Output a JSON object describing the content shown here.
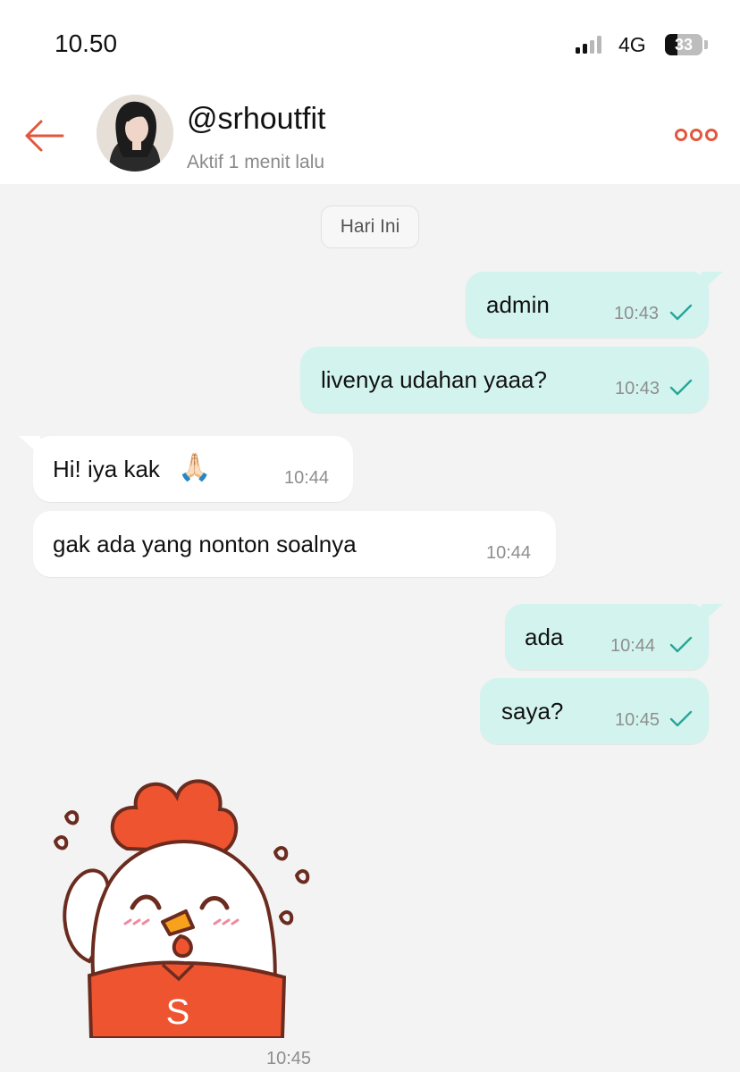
{
  "status_bar": {
    "time": "10.50",
    "network": "4G",
    "battery_level": "33"
  },
  "header": {
    "contact_name": "@srhoutfit",
    "contact_status": "Aktif 1 menit lalu",
    "accent_color": "#e2573c"
  },
  "chat": {
    "date_label": "Hari Ini",
    "messages": [
      {
        "direction": "out",
        "text": "admin",
        "time": "10:43",
        "read": true
      },
      {
        "direction": "out",
        "text": "livenya udahan yaaa?",
        "time": "10:43",
        "read": true
      },
      {
        "direction": "in",
        "text": "Hi! iya kak",
        "emoji": "🙏🏻",
        "time": "10:44"
      },
      {
        "direction": "in",
        "text": "gak ada yang nonton soalnya",
        "time": "10:44"
      },
      {
        "direction": "out",
        "text": "ada",
        "time": "10:44",
        "read": true
      },
      {
        "direction": "out",
        "text": "saya?",
        "time": "10:45",
        "read": true
      }
    ],
    "sticker": {
      "letter": "S",
      "time": "10:45",
      "icon": "chicken-mascot-sticker"
    }
  }
}
